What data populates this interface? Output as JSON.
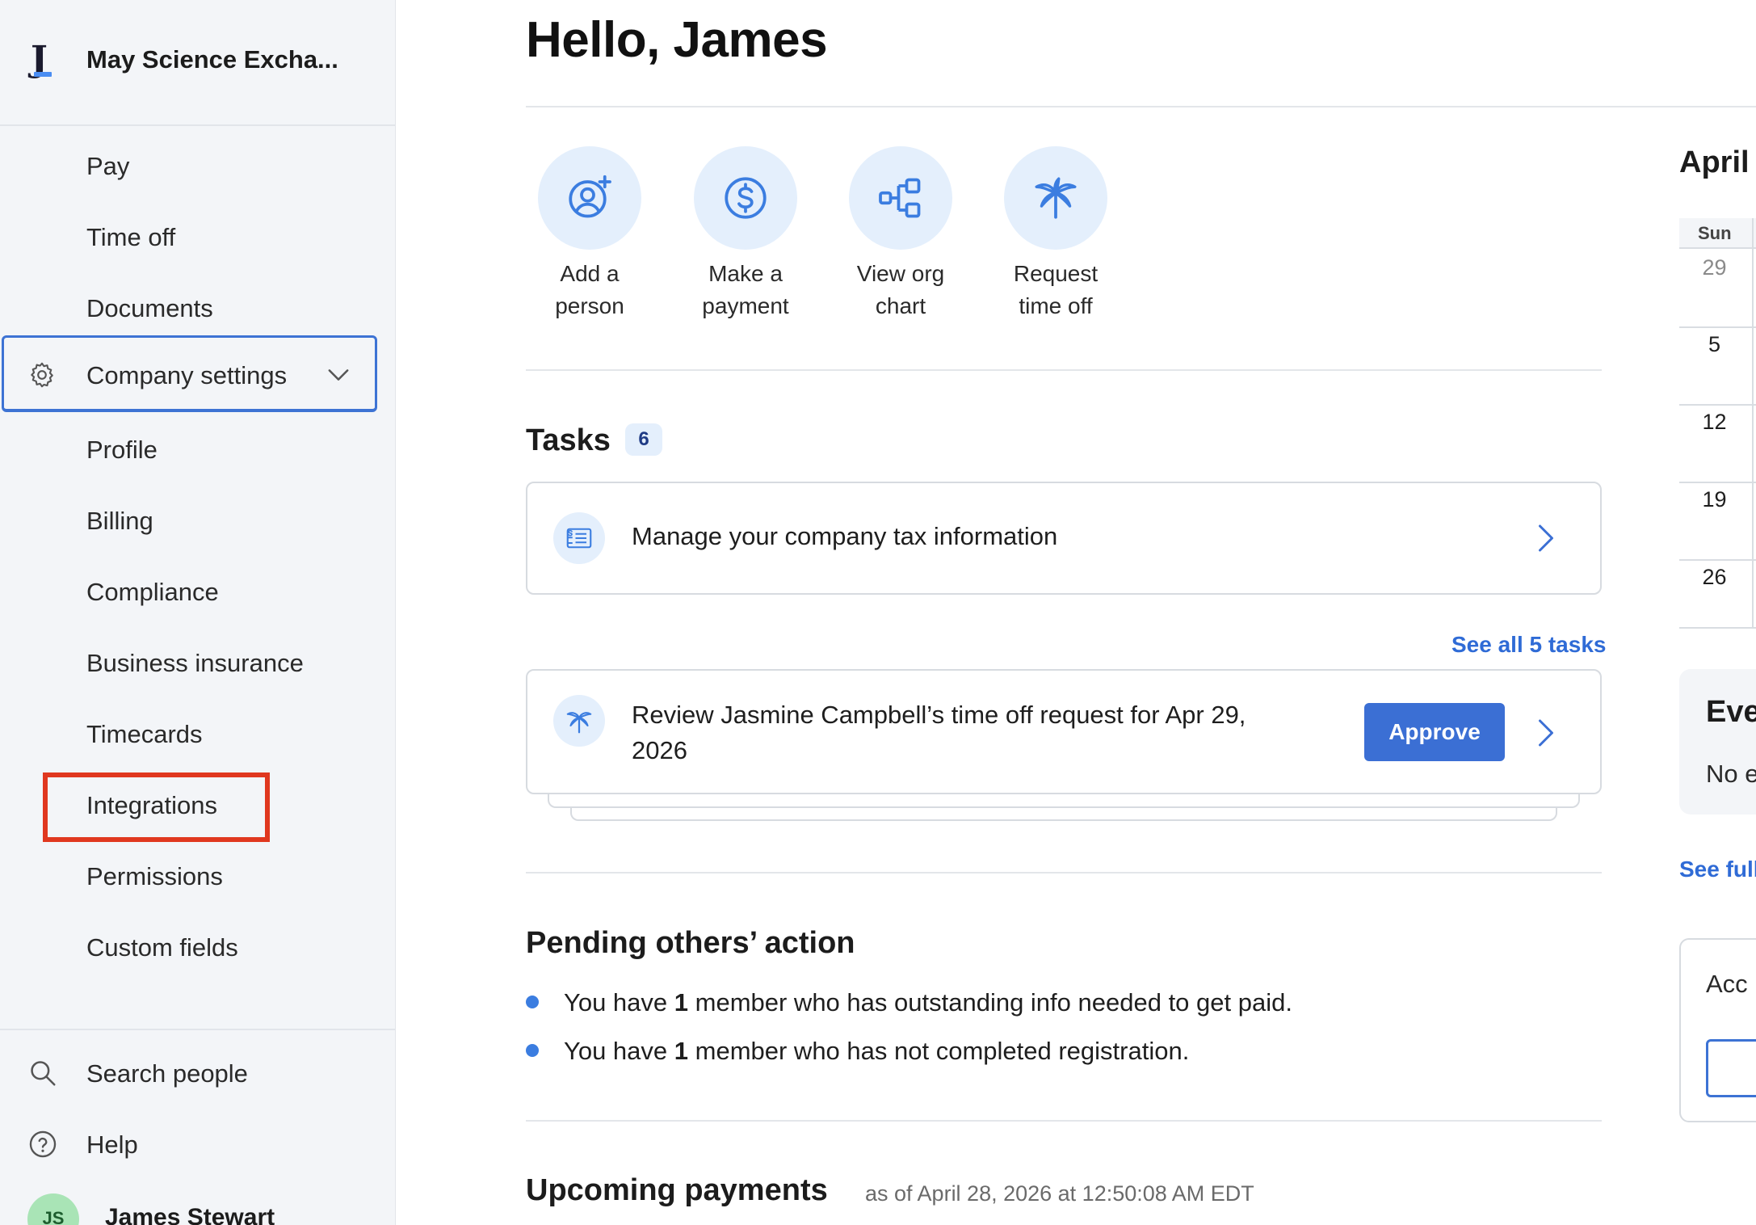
{
  "sidebar": {
    "org_initial": "J",
    "org_name": "May Science Excha...",
    "items_top": [
      {
        "label": "Pay"
      },
      {
        "label": "Time off"
      },
      {
        "label": "Documents"
      }
    ],
    "settings": {
      "label": "Company settings",
      "icon": "gear-icon",
      "expanded": true
    },
    "settings_items": [
      {
        "label": "Profile"
      },
      {
        "label": "Billing"
      },
      {
        "label": "Compliance"
      },
      {
        "label": "Business insurance"
      },
      {
        "label": "Timecards"
      },
      {
        "label": "Integrations"
      },
      {
        "label": "Permissions"
      },
      {
        "label": "Custom fields"
      }
    ],
    "footer": {
      "search_label": "Search people",
      "help_label": "Help",
      "user_initials": "JS",
      "user_name": "James Stewart"
    }
  },
  "main": {
    "greeting": "Hello, James",
    "quick_actions": [
      {
        "line1": "Add a",
        "line2": "person",
        "icon": "add-person-icon"
      },
      {
        "line1": "Make a",
        "line2": "payment",
        "icon": "dollar-icon"
      },
      {
        "line1": "View org",
        "line2": "chart",
        "icon": "org-chart-icon"
      },
      {
        "line1": "Request",
        "line2": "time off",
        "icon": "palm-tree-icon"
      }
    ],
    "tasks": {
      "title": "Tasks",
      "count": "6",
      "first_task": "Manage your company tax information",
      "see_all": "See all 5 tasks",
      "review_line1": "Review Jasmine Campbell’s time off request for Apr 29,",
      "review_line2": "2026",
      "approve_label": "Approve"
    },
    "pending": {
      "title": "Pending others’ action",
      "items": [
        {
          "prefix": "You have ",
          "count": "1",
          "suffix": " member who has outstanding info needed to get paid."
        },
        {
          "prefix": "You have ",
          "count": "1",
          "suffix": " member who has not completed registration."
        }
      ]
    },
    "upcoming": {
      "title": "Upcoming payments",
      "as_of": "as of April 28, 2026 at 12:50:08 AM EDT"
    }
  },
  "right_panel": {
    "calendar_month": "April",
    "weekday": "Sun",
    "days": [
      "29",
      "5",
      "12",
      "19",
      "26"
    ],
    "events_title": "Eve",
    "events_text": "No e",
    "see_full": "See full",
    "acc_text": "Acc"
  },
  "colors": {
    "accent": "#3b6fd4",
    "highlight": "#e0381f",
    "sidebar_bg": "#f3f5f8",
    "icon_bg": "#e4effc"
  }
}
